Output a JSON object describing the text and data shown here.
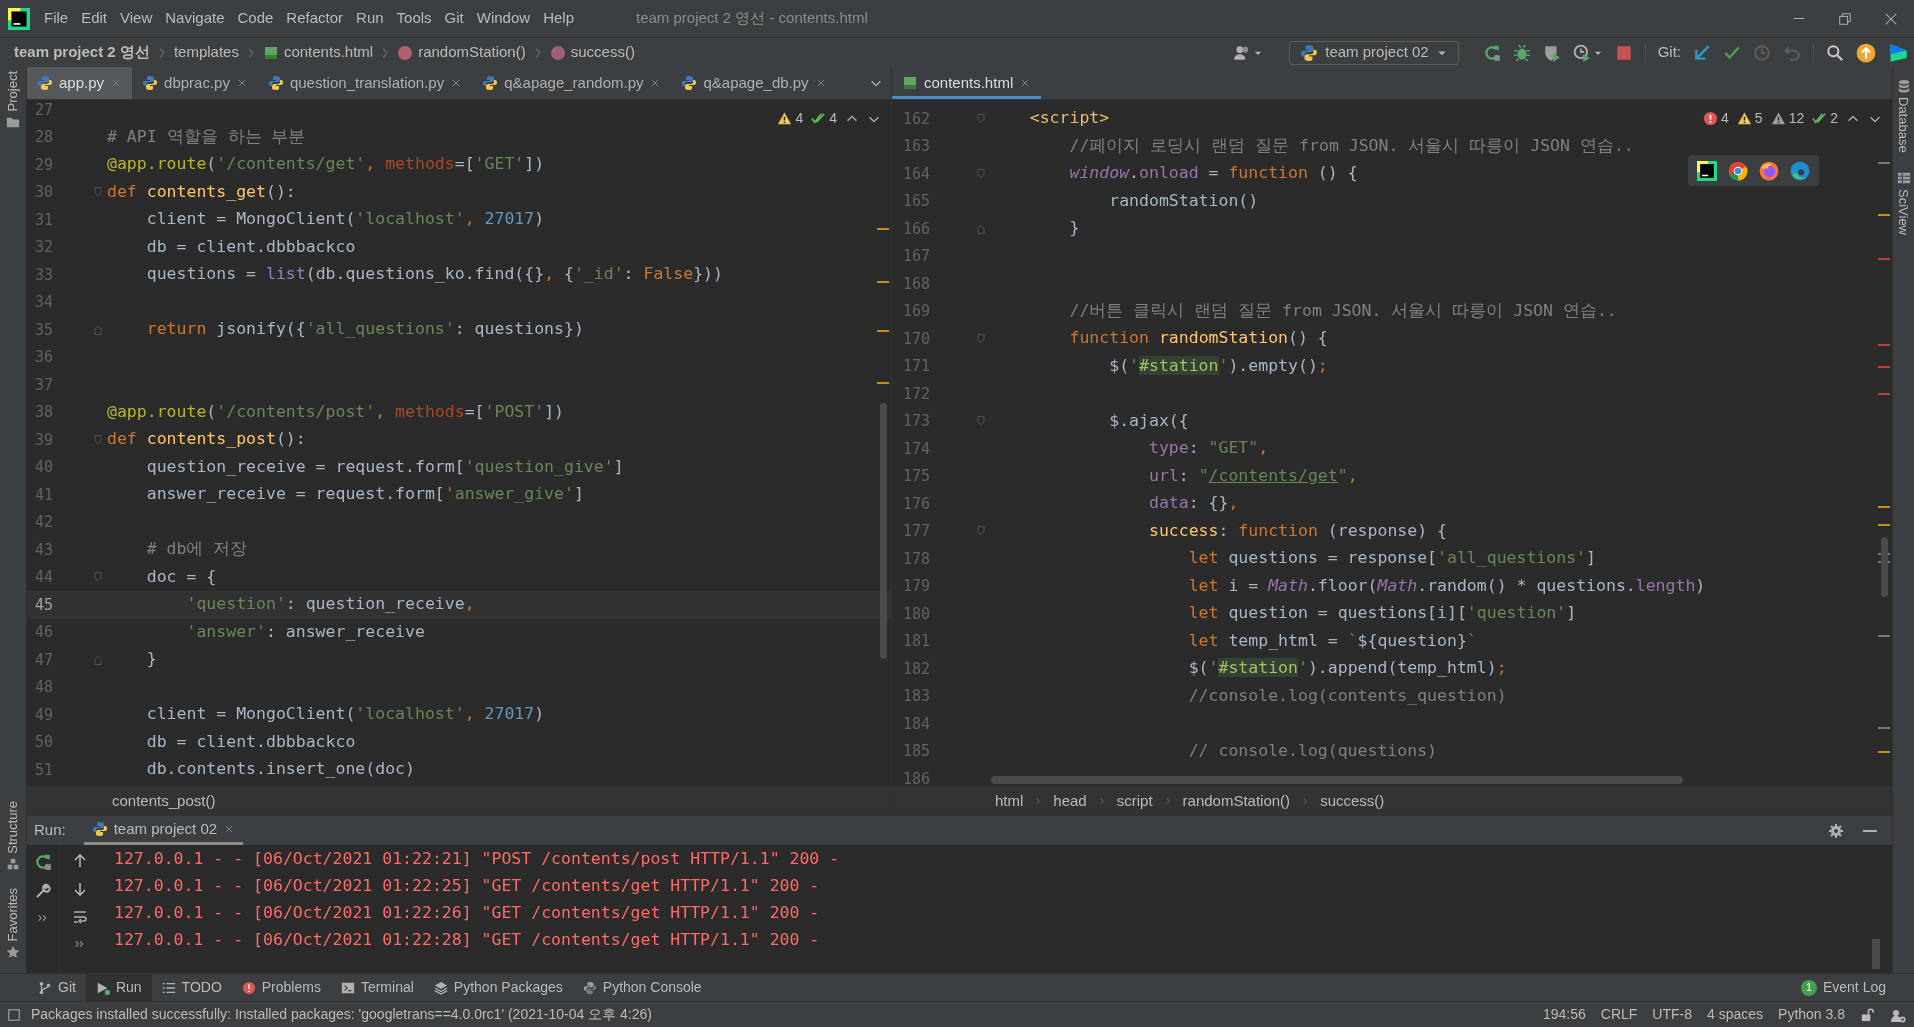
{
  "menu": [
    "File",
    "Edit",
    "View",
    "Navigate",
    "Code",
    "Refactor",
    "Run",
    "Tools",
    "Git",
    "Window",
    "Help"
  ],
  "window_title": "team project 2 영선 - contents.html",
  "breadcrumbs": [
    {
      "label": "team project 2 영선",
      "kind": "project"
    },
    {
      "label": "templates",
      "kind": "folder"
    },
    {
      "label": "contents.html",
      "kind": "html"
    },
    {
      "label": "randomStation()",
      "kind": "function"
    },
    {
      "label": "success()",
      "kind": "method"
    }
  ],
  "run_config": "team project 02",
  "git_label": "Git:",
  "left_stripe": {
    "top": [
      "Project"
    ],
    "bottom": [
      "Structure",
      "Favorites"
    ]
  },
  "right_stripe": [
    "Database",
    "SciView"
  ],
  "left_editor": {
    "focused": false,
    "tabs": [
      {
        "label": "app.py",
        "selected": true
      },
      {
        "label": "dbprac.py",
        "selected": false
      },
      {
        "label": "question_translation.py",
        "selected": false
      },
      {
        "label": "q&apage_random.py",
        "selected": false
      },
      {
        "label": "q&apage_db.py",
        "selected": false
      }
    ],
    "inspection": [
      {
        "kind": "warning",
        "count": "4"
      },
      {
        "kind": "ok",
        "count": "4"
      }
    ],
    "lines": [
      {
        "number": "27",
        "current": false
      },
      {
        "number": "28",
        "current": false,
        "tokens": [
          {
            "text": "# API 역할을 하는 부분",
            "kind": "comment"
          }
        ]
      },
      {
        "number": "29",
        "current": false,
        "tokens": [
          {
            "text": "@app.route",
            "kind": "decorator"
          },
          {
            "text": "(",
            "kind": "plain"
          },
          {
            "text": "'/contents/get'",
            "kind": "string"
          },
          {
            "text": ", ",
            "kind": "keyword"
          },
          {
            "text": "methods",
            "kind": "param"
          },
          {
            "text": "=[",
            "kind": "plain"
          },
          {
            "text": "'GET'",
            "kind": "string"
          },
          {
            "text": "])",
            "kind": "plain"
          }
        ]
      },
      {
        "number": "30",
        "current": false,
        "fold_start": true,
        "tokens": [
          {
            "text": "def ",
            "kind": "keyword"
          },
          {
            "text": "contents_get",
            "kind": "function"
          },
          {
            "text": "():",
            "kind": "plain"
          }
        ]
      },
      {
        "number": "31",
        "current": false,
        "tokens": [
          {
            "text": "    client = MongoClient(",
            "kind": "plain"
          },
          {
            "text": "'localhost'",
            "kind": "string"
          },
          {
            "text": ", ",
            "kind": "keyword"
          },
          {
            "text": "27017",
            "kind": "number"
          },
          {
            "text": ")",
            "kind": "plain"
          }
        ]
      },
      {
        "number": "32",
        "current": false,
        "tokens": [
          {
            "text": "    db = client.dbbbackco",
            "kind": "plain"
          }
        ]
      },
      {
        "number": "33",
        "current": false,
        "tokens": [
          {
            "text": "    questions = ",
            "kind": "plain"
          },
          {
            "text": "list",
            "kind": "builtin"
          },
          {
            "text": "(db.questions_ko.find({}",
            "kind": "plain"
          },
          {
            "text": ", ",
            "kind": "keyword"
          },
          {
            "text": "{",
            "kind": "plain"
          },
          {
            "text": "'_id'",
            "kind": "string"
          },
          {
            "text": ": ",
            "kind": "plain"
          },
          {
            "text": "False",
            "kind": "keyword"
          },
          {
            "text": "}))",
            "kind": "plain"
          }
        ]
      },
      {
        "number": "34",
        "current": false
      },
      {
        "number": "35",
        "current": false,
        "fold_end": true,
        "tokens": [
          {
            "text": "    return",
            "kind": "keyword"
          },
          {
            "text": " jsonify({",
            "kind": "plain"
          },
          {
            "text": "'all_questions'",
            "kind": "string"
          },
          {
            "text": ": questions})",
            "kind": "plain"
          }
        ]
      },
      {
        "number": "36",
        "current": false
      },
      {
        "number": "37",
        "current": false
      },
      {
        "number": "38",
        "current": false,
        "tokens": [
          {
            "text": "@app.route",
            "kind": "decorator"
          },
          {
            "text": "(",
            "kind": "plain"
          },
          {
            "text": "'/contents/post'",
            "kind": "string"
          },
          {
            "text": ", ",
            "kind": "keyword"
          },
          {
            "text": "methods",
            "kind": "param"
          },
          {
            "text": "=[",
            "kind": "plain"
          },
          {
            "text": "'POST'",
            "kind": "string"
          },
          {
            "text": "])",
            "kind": "plain"
          }
        ]
      },
      {
        "number": "39",
        "current": false,
        "fold_start": true,
        "tokens": [
          {
            "text": "def ",
            "kind": "keyword"
          },
          {
            "text": "contents_post",
            "kind": "function"
          },
          {
            "text": "():",
            "kind": "plain"
          }
        ]
      },
      {
        "number": "40",
        "current": false,
        "tokens": [
          {
            "text": "    question_receive = request.form[",
            "kind": "plain"
          },
          {
            "text": "'question_give'",
            "kind": "string"
          },
          {
            "text": "]",
            "kind": "plain"
          }
        ]
      },
      {
        "number": "41",
        "current": false,
        "tokens": [
          {
            "text": "    answer_receive = request.form[",
            "kind": "plain"
          },
          {
            "text": "'answer_give'",
            "kind": "string"
          },
          {
            "text": "]",
            "kind": "plain"
          }
        ]
      },
      {
        "number": "42",
        "current": false
      },
      {
        "number": "43",
        "current": false,
        "tokens": [
          {
            "text": "    # db에 저장",
            "kind": "comment"
          }
        ]
      },
      {
        "number": "44",
        "current": false,
        "fold_start": true,
        "tokens": [
          {
            "text": "    doc = {",
            "kind": "plain"
          }
        ]
      },
      {
        "number": "45",
        "current": true,
        "tokens": [
          {
            "text": "        'question'",
            "kind": "string"
          },
          {
            "text": ": question_receive",
            "kind": "plain"
          },
          {
            "text": ",",
            "kind": "keyword"
          }
        ]
      },
      {
        "number": "46",
        "current": false,
        "tokens": [
          {
            "text": "        'answer'",
            "kind": "string"
          },
          {
            "text": ": answer_receive",
            "kind": "plain"
          }
        ]
      },
      {
        "number": "47",
        "current": false,
        "fold_end": true,
        "tokens": [
          {
            "text": "    }",
            "kind": "plain"
          }
        ]
      },
      {
        "number": "48",
        "current": false
      },
      {
        "number": "49",
        "current": false,
        "tokens": [
          {
            "text": "    client = MongoClient(",
            "kind": "plain"
          },
          {
            "text": "'localhost'",
            "kind": "string"
          },
          {
            "text": ", ",
            "kind": "keyword"
          },
          {
            "text": "27017",
            "kind": "number"
          },
          {
            "text": ")",
            "kind": "plain"
          }
        ]
      },
      {
        "number": "50",
        "current": false,
        "tokens": [
          {
            "text": "    db = client.dbbbackco",
            "kind": "plain"
          }
        ]
      },
      {
        "number": "51",
        "current": false,
        "tokens": [
          {
            "text": "    db.contents.insert_one(doc)",
            "kind": "plain"
          }
        ]
      }
    ],
    "breadcrumb": [
      "contents_post()"
    ]
  },
  "right_editor": {
    "focused": true,
    "tabs": [
      {
        "label": "contents.html",
        "selected": true
      }
    ],
    "inspection": [
      {
        "kind": "error",
        "count": "4"
      },
      {
        "kind": "warning",
        "count": "5"
      },
      {
        "kind": "weak_warning",
        "count": "12"
      },
      {
        "kind": "ok",
        "count": "2"
      }
    ],
    "lines": [
      {
        "number": "162",
        "current": false,
        "fold_start": true,
        "tokens": [
          {
            "text": "    <script>",
            "kind": "tag"
          }
        ]
      },
      {
        "number": "163",
        "current": false,
        "tokens": [
          {
            "text": "        //페이지 로딩시 랜덤 질문 from JSON. 서울시 따릉이 JSON 연습..",
            "kind": "comment"
          }
        ]
      },
      {
        "number": "164",
        "current": false,
        "fold_start": true,
        "tokens": [
          {
            "text": "        window",
            "kind": "global"
          },
          {
            "text": ".",
            "kind": "plain"
          },
          {
            "text": "onload",
            "kind": "property"
          },
          {
            "text": " = ",
            "kind": "plain"
          },
          {
            "text": "function",
            "kind": "keyword"
          },
          {
            "text": " () {",
            "kind": "plain"
          }
        ]
      },
      {
        "number": "165",
        "current": false,
        "tokens": [
          {
            "text": "            randomStation()",
            "kind": "plain"
          }
        ]
      },
      {
        "number": "166",
        "current": false,
        "fold_end": true,
        "tokens": [
          {
            "text": "        }",
            "kind": "plain"
          }
        ]
      },
      {
        "number": "167",
        "current": false
      },
      {
        "number": "168",
        "current": false
      },
      {
        "number": "169",
        "current": false,
        "tokens": [
          {
            "text": "        //버튼 클릭시 랜덤 질문 from JSON. 서울시 따릉이 JSON 연습..",
            "kind": "comment"
          }
        ]
      },
      {
        "number": "170",
        "current": false,
        "fold_start": true,
        "tokens": [
          {
            "text": "        function ",
            "kind": "keyword"
          },
          {
            "text": "randomStation",
            "kind": "function"
          },
          {
            "text": "() {",
            "kind": "plain"
          }
        ]
      },
      {
        "number": "171",
        "current": false,
        "tokens": [
          {
            "text": "            $(",
            "kind": "plain"
          },
          {
            "text": "'",
            "kind": "string"
          },
          {
            "text": "#station",
            "kind": "highlight"
          },
          {
            "text": "'",
            "kind": "string"
          },
          {
            "text": ").empty()",
            "kind": "plain"
          },
          {
            "text": ";",
            "kind": "keyword"
          }
        ]
      },
      {
        "number": "172",
        "current": false
      },
      {
        "number": "173",
        "current": false,
        "fold_start": true,
        "tokens": [
          {
            "text": "            $.ajax({",
            "kind": "plain"
          }
        ]
      },
      {
        "number": "174",
        "current": false,
        "tokens": [
          {
            "text": "                type",
            "kind": "property"
          },
          {
            "text": ": ",
            "kind": "plain"
          },
          {
            "text": "\"GET\"",
            "kind": "string"
          },
          {
            "text": ",",
            "kind": "keyword"
          }
        ]
      },
      {
        "number": "175",
        "current": false,
        "tokens": [
          {
            "text": "                url",
            "kind": "property"
          },
          {
            "text": ": ",
            "kind": "plain"
          },
          {
            "text": "\"",
            "kind": "string"
          },
          {
            "text": "/contents/get",
            "kind": "link"
          },
          {
            "text": "\"",
            "kind": "string"
          },
          {
            "text": ",",
            "kind": "keyword"
          }
        ]
      },
      {
        "number": "176",
        "current": false,
        "tokens": [
          {
            "text": "                data",
            "kind": "property"
          },
          {
            "text": ": {}",
            "kind": "plain"
          },
          {
            "text": ",",
            "kind": "keyword"
          }
        ]
      },
      {
        "number": "177",
        "current": false,
        "fold_start": true,
        "tokens": [
          {
            "text": "                success",
            "kind": "function"
          },
          {
            "text": ": ",
            "kind": "plain"
          },
          {
            "text": "function",
            "kind": "keyword"
          },
          {
            "text": " (response) {",
            "kind": "plain"
          }
        ]
      },
      {
        "number": "178",
        "current": false,
        "tokens": [
          {
            "text": "                    let",
            "kind": "keyword"
          },
          {
            "text": " questions = response[",
            "kind": "plain"
          },
          {
            "text": "'all_questions'",
            "kind": "string"
          },
          {
            "text": "]",
            "kind": "plain"
          }
        ]
      },
      {
        "number": "179",
        "current": false,
        "tokens": [
          {
            "text": "                    let",
            "kind": "keyword"
          },
          {
            "text": " i = ",
            "kind": "plain"
          },
          {
            "text": "Math",
            "kind": "global"
          },
          {
            "text": ".floor(",
            "kind": "plain"
          },
          {
            "text": "Math",
            "kind": "global"
          },
          {
            "text": ".random() * questions.",
            "kind": "plain"
          },
          {
            "text": "length",
            "kind": "property"
          },
          {
            "text": ")",
            "kind": "plain"
          }
        ]
      },
      {
        "number": "180",
        "current": false,
        "tokens": [
          {
            "text": "                    let",
            "kind": "keyword"
          },
          {
            "text": " question = questions[i][",
            "kind": "plain"
          },
          {
            "text": "'question'",
            "kind": "string"
          },
          {
            "text": "]",
            "kind": "plain"
          }
        ]
      },
      {
        "number": "181",
        "current": false,
        "tokens": [
          {
            "text": "                    let",
            "kind": "keyword"
          },
          {
            "text": " temp_html = ",
            "kind": "plain"
          },
          {
            "text": "`",
            "kind": "string"
          },
          {
            "text": "${question}",
            "kind": "plain"
          },
          {
            "text": "`",
            "kind": "string"
          }
        ]
      },
      {
        "number": "182",
        "current": false,
        "tokens": [
          {
            "text": "                    $(",
            "kind": "plain"
          },
          {
            "text": "'",
            "kind": "string"
          },
          {
            "text": "#station",
            "kind": "highlight"
          },
          {
            "text": "'",
            "kind": "string"
          },
          {
            "text": ").append(temp_html)",
            "kind": "plain"
          },
          {
            "text": ";",
            "kind": "keyword"
          }
        ]
      },
      {
        "number": "183",
        "current": false,
        "tokens": [
          {
            "text": "                    //console.log(contents_question)",
            "kind": "comment"
          }
        ]
      },
      {
        "number": "184",
        "current": false
      },
      {
        "number": "185",
        "current": false,
        "tokens": [
          {
            "text": "                    // console.log(questions)",
            "kind": "comment"
          }
        ]
      },
      {
        "number": "186",
        "current": false
      }
    ],
    "breadcrumb": [
      "html",
      "head",
      "script",
      "randomStation()",
      "success()"
    ]
  },
  "run": {
    "label": "Run:",
    "tab": "team project 02",
    "lines": [
      "127.0.0.1 - - [06/Oct/2021 01:22:21] \"POST /contents/post HTTP/1.1\" 200 -",
      "127.0.0.1 - - [06/Oct/2021 01:22:25] \"GET /contents/get HTTP/1.1\" 200 -",
      "127.0.0.1 - - [06/Oct/2021 01:22:26] \"GET /contents/get HTTP/1.1\" 200 -",
      "127.0.0.1 - - [06/Oct/2021 01:22:28] \"GET /contents/get HTTP/1.1\" 200 -"
    ]
  },
  "tool_tabs": [
    {
      "label": "Git",
      "selected": false
    },
    {
      "label": "Run",
      "selected": true
    },
    {
      "label": "TODO",
      "selected": false
    },
    {
      "label": "Problems",
      "selected": false
    },
    {
      "label": "Terminal",
      "selected": false
    },
    {
      "label": "Python Packages",
      "selected": false
    },
    {
      "label": "Python Console",
      "selected": false
    }
  ],
  "event_log": {
    "count": "1",
    "label": "Event Log"
  },
  "status": {
    "message": "Packages installed successfully: Installed packages: 'googletrans==4.0.0rc1' (2021-10-04 오후 4:26)",
    "items": [
      "194:56",
      "CRLF",
      "UTF-8",
      "4 spaces",
      "Python 3.8"
    ]
  }
}
